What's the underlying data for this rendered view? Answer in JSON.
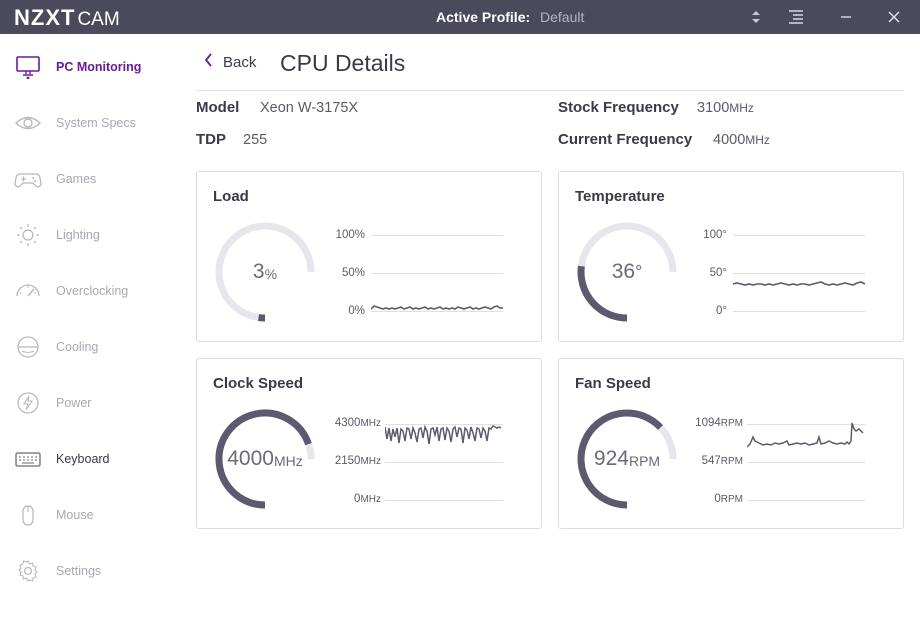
{
  "app": {
    "logo_main": "NZXT",
    "logo_sub": "CAM",
    "profile_label": "Active Profile:",
    "profile_value": "Default"
  },
  "sidebar": {
    "items": [
      {
        "label": "PC Monitoring",
        "icon": "monitor-icon",
        "state": "active"
      },
      {
        "label": "System Specs",
        "icon": "eye-icon",
        "state": "inactive"
      },
      {
        "label": "Games",
        "icon": "gamepad-icon",
        "state": "inactive"
      },
      {
        "label": "Lighting",
        "icon": "sun-icon",
        "state": "inactive"
      },
      {
        "label": "Overclocking",
        "icon": "speedometer-icon",
        "state": "inactive"
      },
      {
        "label": "Cooling",
        "icon": "fan-icon",
        "state": "inactive"
      },
      {
        "label": "Power",
        "icon": "power-bolt-icon",
        "state": "inactive"
      },
      {
        "label": "Keyboard",
        "icon": "keyboard-icon",
        "state": "dark"
      },
      {
        "label": "Mouse",
        "icon": "mouse-icon",
        "state": "inactive"
      },
      {
        "label": "Settings",
        "icon": "gear-icon",
        "state": "inactive"
      }
    ]
  },
  "header": {
    "back_label": "Back",
    "title": "CPU Details"
  },
  "specs": {
    "model_key": "Model",
    "model_value": "Xeon W-3175X",
    "tdp_key": "TDP",
    "tdp_value": "255",
    "stock_key": "Stock Frequency",
    "stock_value": "3100",
    "stock_unit": "MHz",
    "current_key": "Current Frequency",
    "current_value": "4000",
    "current_unit": "MHz"
  },
  "cards": {
    "load": {
      "title": "Load",
      "value": "3",
      "unit": "%",
      "fraction": 0.03,
      "axis": [
        "100%",
        "50%",
        "0%"
      ]
    },
    "temperature": {
      "title": "Temperature",
      "value": "36",
      "unit": "°",
      "fraction": 0.36,
      "axis": [
        "100°",
        "50°",
        "0°"
      ]
    },
    "clock": {
      "title": "Clock Speed",
      "value": "4000",
      "unit": "MHz",
      "fraction": 0.93,
      "axis": [
        "4300",
        "2150",
        "0"
      ],
      "axis_unit": "MHz"
    },
    "fan": {
      "title": "Fan Speed",
      "value": "924",
      "unit": "RPM",
      "fraction": 0.84,
      "axis": [
        "1094",
        "547",
        "0"
      ],
      "axis_unit": "RPM"
    }
  },
  "colors": {
    "titlebar": "#4a4a5c",
    "accent": "#6a1b9a",
    "gauge_fill": "#5b5a6e",
    "gauge_track": "#e6e7ec"
  }
}
